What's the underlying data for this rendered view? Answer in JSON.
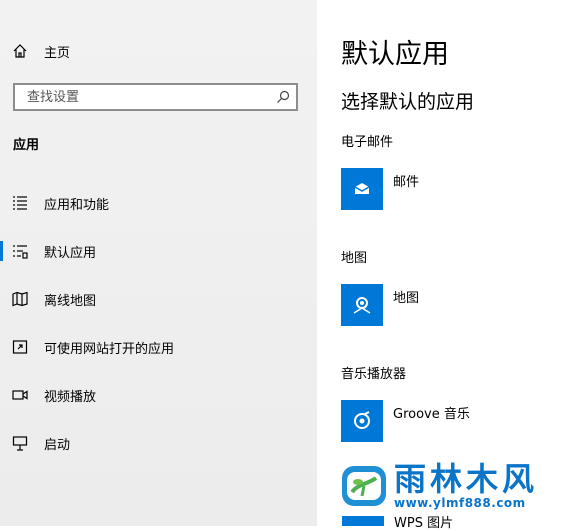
{
  "sidebar": {
    "home_label": "主页",
    "search_placeholder": "查找设置",
    "section_title": "应用",
    "items": [
      {
        "label": "应用和功能",
        "icon": "apps-features-icon"
      },
      {
        "label": "默认应用",
        "icon": "default-apps-icon",
        "active": true
      },
      {
        "label": "离线地图",
        "icon": "offline-maps-icon"
      },
      {
        "label": "可使用网站打开的应用",
        "icon": "apps-for-websites-icon"
      },
      {
        "label": "视频播放",
        "icon": "video-playback-icon"
      },
      {
        "label": "启动",
        "icon": "startup-icon"
      }
    ]
  },
  "main": {
    "title": "默认应用",
    "subtitle": "选择默认的应用",
    "groups": [
      {
        "label": "电子邮件",
        "app": "邮件",
        "icon": "mail-icon"
      },
      {
        "label": "地图",
        "app": "地图",
        "icon": "maps-icon"
      },
      {
        "label": "音乐播放器",
        "app": "Groove 音乐",
        "icon": "groove-music-icon"
      }
    ],
    "partial_app": "WPS 图片"
  },
  "watermark": {
    "name": "雨林木风",
    "url": "www.ylmf888.com"
  },
  "colors": {
    "accent": "#0078d7",
    "watermark": "#0a74c9"
  }
}
